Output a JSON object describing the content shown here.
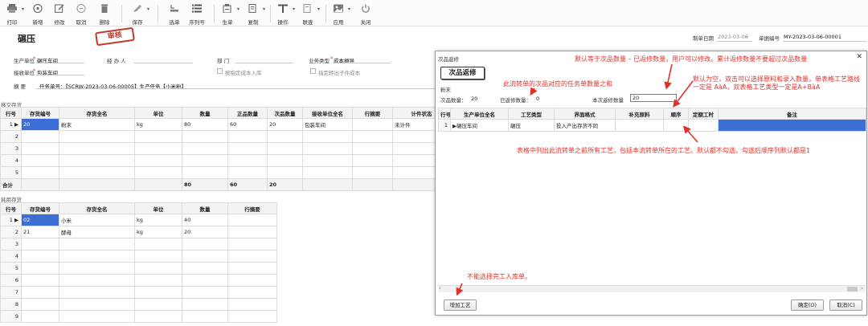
{
  "toolbar": {
    "items": [
      {
        "label": "打印",
        "icon": "printer-icon",
        "dropdown": true
      },
      {
        "label": "新增",
        "icon": "add-circle-icon"
      },
      {
        "label": "修改",
        "icon": "edit-icon"
      },
      {
        "label": "取消",
        "icon": "cancel-circle-icon"
      },
      {
        "label": "删除",
        "icon": "trash-icon"
      },
      {
        "label": "保存",
        "icon": "pen-icon",
        "dropdown": true
      },
      {
        "label": "选单",
        "icon": "pick-list-icon"
      },
      {
        "label": "序列号",
        "icon": "list-icon"
      },
      {
        "label": "生单",
        "icon": "generate-doc-icon",
        "dropdown": true
      },
      {
        "label": "复制",
        "icon": "copy-icon",
        "dropdown": true
      },
      {
        "label": "操作",
        "icon": "operate-icon",
        "dropdown": true
      },
      {
        "label": "联查",
        "icon": "link-query-icon",
        "dropdown": true
      },
      {
        "label": "应用",
        "icon": "apps-icon",
        "dropdown": true
      },
      {
        "label": "关闭",
        "icon": "power-icon"
      }
    ]
  },
  "form": {
    "title": "碾压",
    "stamp": "审核",
    "make_date_label": "制单日期",
    "make_date": "2023-03-06",
    "doc_no_label": "单据编号",
    "doc_no": "MY-2023-03-06-00001",
    "prod_unit_label": "生产单位",
    "prod_unit": "碾压车间",
    "handler_label": "经 办 人",
    "dept_label": "部    门",
    "biz_type_label": "业务类型",
    "biz_type": "成本摊导",
    "recv_unit_label": "接收单位",
    "recv_unit": "包装车间",
    "chk_cost_in": "按指定成本入库",
    "chk_sub_out": "指定转出子件成本",
    "summary_label": "摘    要",
    "summary": "任务单号：【SCRW-2023-03-06-00005】生产任务【小米粉】"
  },
  "output_section": {
    "label": "移交存货",
    "columns": [
      "行号",
      "存货编号",
      "存货全名",
      "单位",
      "数量",
      "正品数量",
      "次品数量",
      "接收单位全名",
      "行摘要",
      "计件状态"
    ],
    "rows": [
      [
        "1",
        "20",
        "粉末",
        "kg",
        "80",
        "60",
        "20",
        "包装车间",
        "",
        "未计件"
      ],
      [
        "2",
        "",
        "",
        "",
        "",
        "",
        "",
        "",
        "",
        ""
      ],
      [
        "3",
        "",
        "",
        "",
        "",
        "",
        "",
        "",
        "",
        ""
      ],
      [
        "4",
        "",
        "",
        "",
        "",
        "",
        "",
        "",
        "",
        ""
      ],
      [
        "5",
        "",
        "",
        "",
        "",
        "",
        "",
        "",
        "",
        ""
      ]
    ],
    "total_label": "合计",
    "totals": {
      "qty": "80",
      "good": "60",
      "defect": "20"
    }
  },
  "consume_section": {
    "label": "耗用存货",
    "columns": [
      "行号",
      "存货编号",
      "存货全名",
      "单位",
      "数量",
      "行摘要"
    ],
    "rows": [
      [
        "1",
        "02",
        "小米",
        "kg",
        "40",
        ""
      ],
      [
        "2",
        "21",
        "酵母",
        "kg",
        "20",
        ""
      ],
      [
        "3",
        "",
        "",
        "",
        "",
        ""
      ],
      [
        "4",
        "",
        "",
        "",
        "",
        ""
      ],
      [
        "5",
        "",
        "",
        "",
        "",
        ""
      ],
      [
        "6",
        "",
        "",
        "",
        "",
        ""
      ],
      [
        "7",
        "",
        "",
        "",
        "",
        ""
      ],
      [
        "8",
        "",
        "",
        "",
        "",
        ""
      ],
      [
        "9",
        "",
        "",
        "",
        "",
        ""
      ]
    ]
  },
  "dialog": {
    "title": "次品返修",
    "heading": "次品返修",
    "item_name": "粉末",
    "defect_qty_label": "次品数量：",
    "defect_qty": "20",
    "repaired_label": "已返修数量：",
    "repaired": "0",
    "this_repair_label": "本次返修数量",
    "this_repair": "20",
    "columns": [
      "行号",
      "生产单位全名",
      "工艺类型",
      "界面格式",
      "补充原料",
      "顺序",
      "定额工时",
      "备注"
    ],
    "rows": [
      [
        "1",
        "碾压车间",
        "碾压",
        "投入产出存货不同",
        "",
        "",
        "",
        ""
      ]
    ],
    "add_btn": "增加工艺",
    "ok_btn": "确定(O)",
    "cancel_btn": "取消(C)",
    "close": "✕"
  },
  "annotations": {
    "n1": "默认等于次品数量 – 已返修数量，用户可以修改。累计返修数量不要超过次品数量",
    "n2": "此流转单的次品对应的任务单数量之和",
    "n3": "默认为空，双击可以选择原料和录入数量，单表格工艺路线一定是 AàA，双表格工艺类型一定是A+BàA",
    "n4": "表格中列出此流转单之前所有工艺，包括本流转单所在的工艺。默认都不勾选，勾选后顺序列默认都是1",
    "n5": "不能选择完工入库单。"
  },
  "colors": {
    "accent": "#3b6fd6",
    "annotation": "#e0322b",
    "stamp": "#c0392b"
  }
}
